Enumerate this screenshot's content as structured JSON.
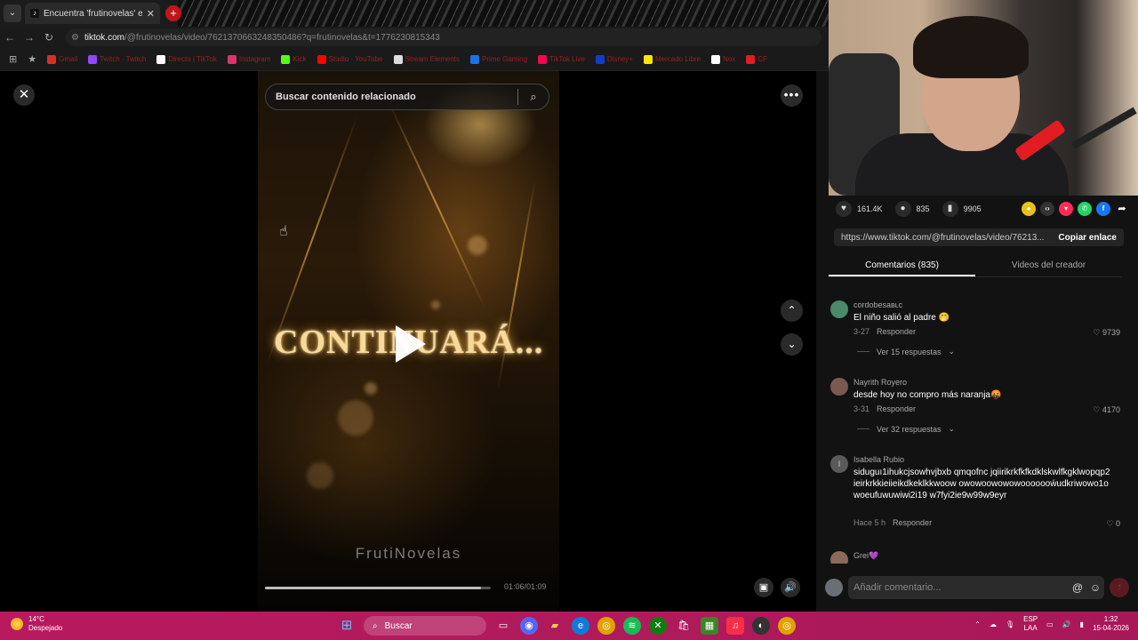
{
  "browser": {
    "tab_title": "Encuentra 'frutinovelas' en TikT",
    "tab_close": "✕",
    "new_tab": "+",
    "url_host": "tiktok.com",
    "url_path": "/@frutinovelas/video/7621370663248350486?q=frutinovelas&t=1776230815343",
    "bookmarks": [
      {
        "label": "Gmail",
        "color": "#d93025"
      },
      {
        "label": "Twitch · Twitch",
        "color": "#9146ff"
      },
      {
        "label": "Directo | TikTok",
        "color": "#ffffff"
      },
      {
        "label": "Instagram",
        "color": "#e1306c"
      },
      {
        "label": "Kick",
        "color": "#53fc18"
      },
      {
        "label": "Studio · YouTube",
        "color": "#ff0000"
      },
      {
        "label": "Stream Elements",
        "color": "#dddddd"
      },
      {
        "label": "Prime Gaming",
        "color": "#1a73e8"
      },
      {
        "label": "TikTok Live",
        "color": "#ff0050"
      },
      {
        "label": "Disney+",
        "color": "#113ccf"
      },
      {
        "label": "Mercado Libre",
        "color": "#ffe600"
      },
      {
        "label": "Nox",
        "color": "#ffffff"
      },
      {
        "label": "CF",
        "color": "#e11c22"
      }
    ]
  },
  "video": {
    "search_placeholder": "Buscar contenido relacionado",
    "overlay_text": "CONTINUARÁ...",
    "watermark": "FrutiNovelas",
    "time": "01:06/01:09",
    "progress": 0.956
  },
  "actions": {
    "likes": "161.4K",
    "comments": "835",
    "saves": "9905"
  },
  "link": {
    "url": "https://www.tiktok.com/@frutinovelas/video/76213...",
    "copy_label": "Copiar enlace"
  },
  "tabs": {
    "comments": "Comentarios (835)",
    "creator": "Videos del creador"
  },
  "comments": [
    {
      "user": "cordobesaʙʟᴄ",
      "text": "El niño salió al padre 🤭",
      "date": "3-27",
      "reply": "Responder",
      "likes": "9739",
      "more": "Ver 15 respuestas",
      "avatar": "#4a8a6a"
    },
    {
      "user": "Nayrith Royero",
      "text": "desde hoy no compro más naranja🤬",
      "date": "3-31",
      "reply": "Responder",
      "likes": "4170",
      "more": "Ver 32 respuestas",
      "avatar": "#7a5a50"
    },
    {
      "user": "Isabella Rubio",
      "text": "siduguı1ihukcjsowhvjbxb qmqofnc jqiirikrkfkfkdklskwlfkgklwopqp2ieirkrkkieiieikdkeklkkwoow owowoowowowooooooẃudkriwowo1owoeufuwuwiwi2i19 w7fyi2ie9w99w9eyr",
      "date": "Hace 5 h",
      "reply": "Responder",
      "likes": "0",
      "avatar": "#5a5a5a",
      "initial": "I"
    },
    {
      "user": "Grei💜",
      "text": "",
      "avatar": "#8a6a5a"
    }
  ],
  "composer": {
    "placeholder": "Añadir comentario..."
  },
  "taskbar": {
    "temp": "14°C",
    "weather": "Despejado",
    "search": "Buscar",
    "lang1": "ESP",
    "lang2": "LAA",
    "time": "1:32",
    "date": "15-04-2026"
  }
}
